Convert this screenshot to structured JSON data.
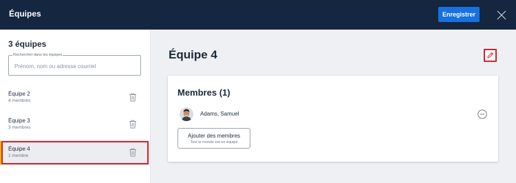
{
  "header": {
    "title": "Équipes",
    "save_label": "Enregistrer"
  },
  "sidebar": {
    "count_label": "3 équipes",
    "search": {
      "legend": "Rechercher dans les équipes",
      "placeholder": "Prénom, nom ou adresse courriel",
      "value": ""
    },
    "teams": [
      {
        "name": "Équipe 2",
        "members": "4 membres"
      },
      {
        "name": "Équipe 3",
        "members": "3 membres"
      },
      {
        "name": "Équipe 4",
        "members": "1 membre",
        "selected": true
      }
    ]
  },
  "main": {
    "title": "Équipe 4",
    "members_card": {
      "title": "Membres (1)",
      "members": [
        {
          "name": "Adams, Samuel"
        }
      ],
      "add_button": {
        "label": "Ajouter des membres",
        "sublabel": "Tout le monde est en équipe"
      }
    }
  },
  "colors": {
    "topbar": "#142640",
    "primary_button": "#1672e0",
    "highlight_outline": "#d4202d",
    "selected_accent": "#f4b400"
  },
  "icons": {
    "close": "close-icon",
    "trash": "trash-icon",
    "edit": "pencil-icon",
    "remove_member": "minus-circle-icon"
  }
}
